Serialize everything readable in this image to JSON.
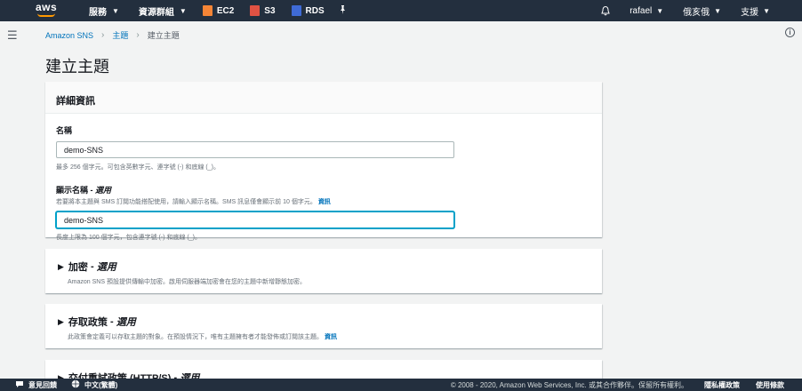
{
  "topnav": {
    "logo_text": "aws",
    "services_label": "服務",
    "resource_groups_label": "資源群組",
    "shortcuts": [
      {
        "label": "EC2",
        "color": "#f58536",
        "icon": "ec2-icon"
      },
      {
        "label": "S3",
        "color": "#e05243",
        "icon": "s3-icon"
      },
      {
        "label": "RDS",
        "color": "#3f6bd6",
        "icon": "rds-icon"
      }
    ],
    "pin_icon": "pin-icon",
    "user_label": "rafael",
    "region_label": "俄亥俄",
    "support_label": "支援"
  },
  "breadcrumb": {
    "root": "Amazon SNS",
    "topics": "主題",
    "current": "建立主題"
  },
  "page_title": "建立主題",
  "details": {
    "header": "詳細資訊",
    "name_label": "名稱",
    "name_value": "demo-SNS",
    "name_constraint": "最多 256 個字元。可包含英數字元、連字號 (-) 和底線 (_)。",
    "display_name_label": "顯示名稱",
    "display_name_optional": "選用",
    "display_name_desc": "若要將本主題與 SMS 訂閱功能搭配使用，請輸入顯示名稱。SMS 訊息僅會顯示前 10 個字元。",
    "info_link": "資訊",
    "display_name_value": "demo-SNS",
    "display_name_constraint": "長度上限為 100 個字元，包含連字號 (-) 和底線 (_)。"
  },
  "sections": [
    {
      "title": "加密",
      "optional": "選用",
      "desc": "Amazon SNS 預設提供傳輸中加密。啟用伺服器端加密會在您的主題中新增靜態加密。",
      "link": ""
    },
    {
      "title": "存取政策",
      "optional": "選用",
      "desc": "此政策會定義可以存取主題的對象。在預設情況下，唯有主題擁有者才能發佈或訂閱該主題。",
      "link": "資訊"
    },
    {
      "title": "交付重試政策 (HTTP/S)",
      "optional": "選用",
      "desc": "",
      "link": ""
    }
  ],
  "footer": {
    "feedback": "意見回饋",
    "language": "中文(繁體)",
    "copyright": "© 2008 - 2020, Amazon Web Services, Inc. 或其合作夥伴。保留所有權利。",
    "privacy": "隱私權政策",
    "terms": "使用條款"
  }
}
